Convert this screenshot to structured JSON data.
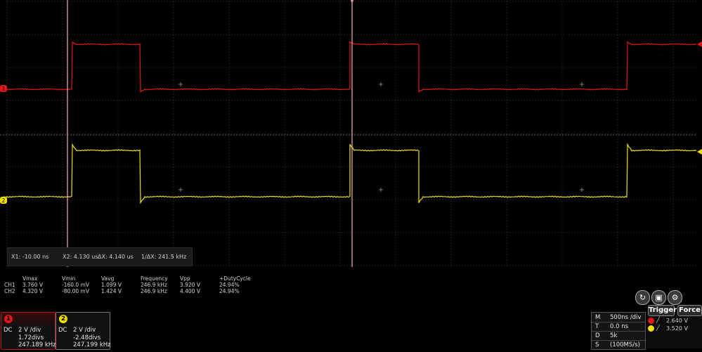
{
  "cursor_readout": {
    "x1": "X1: -10.00 ns",
    "x2": "X2: 4.130 us",
    "dx": "ΔX: 4.140 us",
    "inv_dx": "1/ΔX: 241.5 kHz"
  },
  "measurements": {
    "headers": [
      "Vmax",
      "Vmin",
      "Vavg",
      "Frequency",
      "Vpp",
      "+DutyCycle"
    ],
    "rows": [
      {
        "label": "CH1",
        "values": [
          "3.760 V",
          "-160.0 mV",
          "1.099 V",
          "246.9 kHz",
          "3.920 V",
          "24.94%"
        ]
      },
      {
        "label": "CH2",
        "values": [
          "4.320 V",
          "-80.00 mV",
          "1.424 V",
          "246.9 kHz",
          "4.400 V",
          "24.94%"
        ]
      }
    ]
  },
  "channels": [
    {
      "number": "1",
      "coupling": "DC",
      "scale": "2 V /div",
      "offset": "1.72divs",
      "freq": "247.189 kHz",
      "color": "#e01818"
    },
    {
      "number": "2",
      "coupling": "DC",
      "scale": "2 V /div",
      "offset": "-2.48divs",
      "freq": "247.199 kHz",
      "color": "#f0e000"
    }
  ],
  "timebase": {
    "m_key": "M",
    "m_val": "500ns /div",
    "t_key": "T",
    "t_val": "0.0 ns",
    "d_key": "D",
    "d_val": "5k",
    "s_key": "S",
    "s_val": "(100MS/s)"
  },
  "trigger": {
    "trigger_label": "Trigger",
    "force_label": "Force",
    "ch1_level": "2.640 V",
    "ch2_level": "3.520 V"
  },
  "markers": {
    "ch1": "1",
    "ch2": "2"
  },
  "icons": [
    "refresh-icon",
    "save-icon",
    "settings-icon"
  ],
  "colors": {
    "ch1": "#e01818",
    "ch2": "#f0e000",
    "cursor": "#f4b0b0",
    "grid": "#5a5a5a"
  }
}
